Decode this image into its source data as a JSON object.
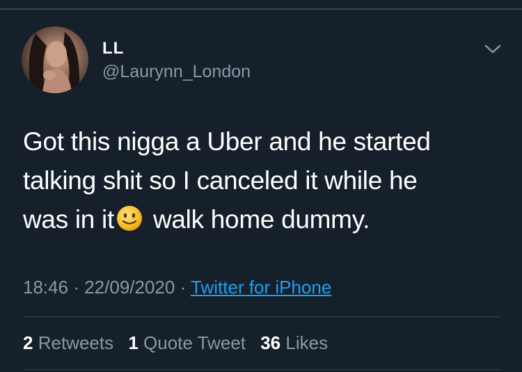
{
  "tweet": {
    "display_name": "LL",
    "handle": "@Laurynn_London",
    "text_lines": [
      "Got this nigga a Uber and he started",
      "talking shit so I canceled it while he",
      "was in it",
      "walk home dummy."
    ],
    "emoji": "slightly-smiling-face-emoji",
    "time": "18:46",
    "date": "22/09/2020",
    "source": "Twitter for iPhone",
    "separator": "·"
  },
  "stats": {
    "retweets_count": "2",
    "retweets_label": "Retweets",
    "quotes_count": "1",
    "quotes_label": "Quote Tweet",
    "likes_count": "36",
    "likes_label": "Likes"
  },
  "icons": {
    "caret": "chevron-down-icon"
  },
  "colors": {
    "background": "#15202b",
    "secondary_text": "#8899a6",
    "link": "#1da1f2",
    "divider": "#38444d"
  }
}
